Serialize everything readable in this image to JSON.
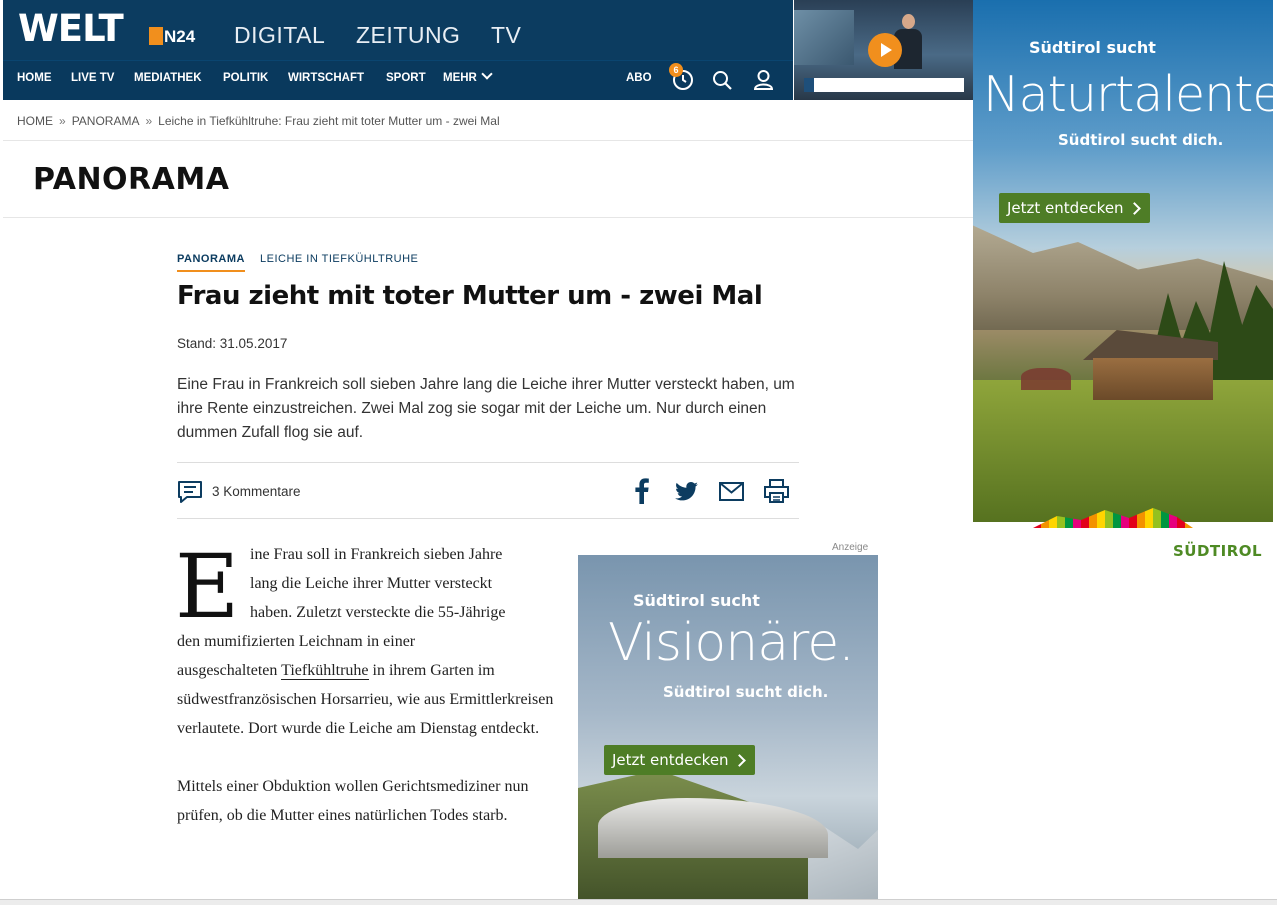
{
  "header": {
    "logo": "WELT",
    "logo_sub": "N24",
    "top_links": [
      "DIGITAL",
      "ZEITUNG",
      "TV"
    ],
    "nav": [
      "HOME",
      "LIVE TV",
      "MEDIATHEK",
      "POLITIK",
      "WIRTSCHAFT",
      "SPORT",
      "MEHR"
    ],
    "abo": "ABO",
    "badge_count": "6"
  },
  "breadcrumb": {
    "items": [
      "HOME",
      "PANORAMA",
      "Leiche in Tiefkühltruhe: Frau zieht mit toter Mutter um - zwei Mal"
    ],
    "separator": "»"
  },
  "section_title": "PANORAMA",
  "article": {
    "kicker_primary": "PANORAMA",
    "kicker_secondary": "LEICHE IN TIEFKÜHLTRUHE",
    "headline": "Frau zieht mit toter Mutter um - zwei Mal",
    "stand": "Stand: 31.05.2017",
    "intro": "Eine Frau in Frankreich soll sieben Jahre lang die Leiche ihrer Mutter versteckt haben, um ihre Rente einzustreichen. Zwei Mal zog sie sogar mit der Leiche um. Nur durch einen dummen Zufall flog sie auf.",
    "comments": "3 Kommentare",
    "dropcap": "E",
    "p1_lines": [
      "ine Frau soll in Frankreich sieben Jahre",
      "lang die Leiche ihrer Mutter versteckt",
      "haben. Zuletzt versteckte die 55-Jährige",
      "den mumifizierten Leichnam in einer"
    ],
    "p1_pre_link": "ausgeschalteten ",
    "p1_link": "Tiefkühltruhe",
    "p1_post_link": " in ihrem Garten im südwestfranzösischen Horsarrieu, wie aus Ermittlerkreisen verlautete. Dort wurde die Leiche am Dienstag entdeckt.",
    "p2": "Mittels einer Obduktion wollen Gerichtsmediziner nun prüfen, ob die Mutter eines natürlichen Todes starb."
  },
  "ad_inline": {
    "label": "Anzeige",
    "line1": "Südtirol sucht",
    "line2": "Visionäre.",
    "line3": "Südtirol sucht dich.",
    "cta": "Jetzt entdecken"
  },
  "ad_right": {
    "line1": "Südtirol sucht",
    "line2": "Naturtalente.",
    "line3": "Südtirol sucht dich.",
    "cta": "Jetzt entdecken",
    "brand": "SÜDTIROL"
  },
  "colors": {
    "header_bg": "#0c3c60",
    "accent": "#f18f1d",
    "ad_green": "#4e7d26"
  },
  "icons": [
    "clock-icon",
    "search-icon",
    "user-icon",
    "comment-icon",
    "facebook-icon",
    "twitter-icon",
    "mail-icon",
    "print-icon",
    "play-icon"
  ]
}
